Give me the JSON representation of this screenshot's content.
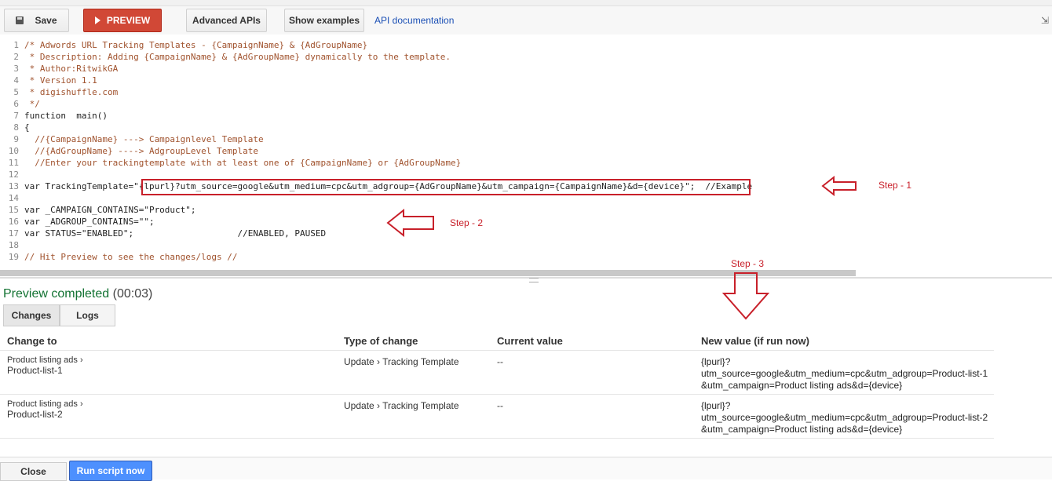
{
  "toolbar": {
    "save_label": "Save",
    "preview_label": "PREVIEW",
    "advanced_label": "Advanced APIs",
    "examples_label": "Show examples",
    "doc_label": "API documentation",
    "collapse_glyph": "⇲"
  },
  "editor": {
    "lines": [
      {
        "n": "1",
        "text": "/* Adwords URL Tracking Templates - {CampaignName} & {AdGroupName}",
        "kind": "comment"
      },
      {
        "n": "2",
        "text": " * Description: Adding {CampaignName} & {AdGroupName} dynamically to the template.",
        "kind": "comment"
      },
      {
        "n": "3",
        "text": " * Author:RitwikGA",
        "kind": "comment"
      },
      {
        "n": "4",
        "text": " * Version 1.1",
        "kind": "comment"
      },
      {
        "n": "5",
        "text": " * digishuffle.com",
        "kind": "comment"
      },
      {
        "n": "6",
        "text": " */",
        "kind": "comment"
      },
      {
        "n": "7",
        "text": "function  main()",
        "kind": "plain"
      },
      {
        "n": "8",
        "text": "{",
        "kind": "plain"
      },
      {
        "n": "9",
        "text": "  //{CampaignName} ---> Campaignlevel Template",
        "kind": "comment"
      },
      {
        "n": "10",
        "text": "  //{AdGroupName} ----> AdgroupLevel Template",
        "kind": "comment"
      },
      {
        "n": "11",
        "text": "  //Enter your trackingtemplate with at least one of {CampaignName} or {AdGroupName}",
        "kind": "comment"
      },
      {
        "n": "12",
        "text": "",
        "kind": "plain"
      },
      {
        "n": "13",
        "text": "var TrackingTemplate=\"{lpurl}?utm_source=google&utm_medium=cpc&utm_adgroup={AdGroupName}&utm_campaign={CampaignName}&d={device}\";  //Example",
        "kind": "plain"
      },
      {
        "n": "14",
        "text": "",
        "kind": "plain"
      },
      {
        "n": "15",
        "text": "var _CAMPAIGN_CONTAINS=\"Product\";",
        "kind": "plain"
      },
      {
        "n": "16",
        "text": "var _ADGROUP_CONTAINS=\"\";",
        "kind": "plain"
      },
      {
        "n": "17",
        "text": "var STATUS=\"ENABLED\";                    //ENABLED, PAUSED",
        "kind": "plain"
      },
      {
        "n": "18",
        "text": "",
        "kind": "plain"
      },
      {
        "n": "19",
        "text": "// Hit Preview to see the changes/logs //",
        "kind": "comment"
      }
    ]
  },
  "annotations": {
    "step1": "Step - 1",
    "step2": "Step - 2",
    "step3": "Step - 3"
  },
  "preview": {
    "status": "Preview completed",
    "time": "(00:03)",
    "tabs": [
      "Changes",
      "Logs"
    ]
  },
  "table": {
    "headers": [
      "Change to",
      "Type of change",
      "Current value",
      "New value (if run now)"
    ],
    "rows": [
      {
        "parent": "Product listing ads",
        "name": "Product-list-1",
        "type_a": "Update",
        "type_b": "Tracking Template",
        "current": "--",
        "new_value": "{lpurl}?\nutm_source=google&utm_medium=cpc&utm_adgroup=Product-list-1&utm_campaign=Product listing ads&d={device}"
      },
      {
        "parent": "Product listing ads",
        "name": "Product-list-2",
        "type_a": "Update",
        "type_b": "Tracking Template",
        "current": "--",
        "new_value": "{lpurl}?\nutm_source=google&utm_medium=cpc&utm_adgroup=Product-list-2&utm_campaign=Product listing ads&d={device}"
      }
    ]
  },
  "footer": {
    "close_label": "Close",
    "run_label": "Run script now"
  },
  "colors": {
    "preview_button": "#d14836",
    "run_button": "#4d90fe",
    "annotation": "#c8202a",
    "status_green": "#137333"
  }
}
